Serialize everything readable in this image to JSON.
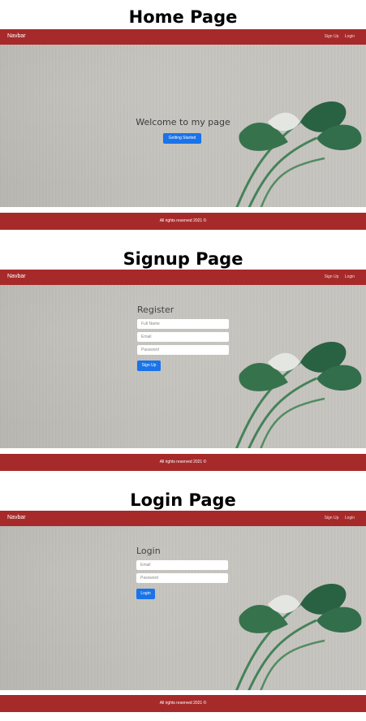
{
  "home": {
    "heading": "Home Page",
    "welcome": "Welcome to my page",
    "button_label": "Getting Started"
  },
  "signup": {
    "heading": "Signup Page",
    "title": "Register",
    "fields": [
      {
        "placeholder": "Full Name"
      },
      {
        "placeholder": "Email"
      },
      {
        "placeholder": "Password"
      }
    ],
    "button_label": "Sign Up"
  },
  "login": {
    "heading": "Login Page",
    "title": "Login",
    "fields": [
      {
        "placeholder": "Email"
      },
      {
        "placeholder": "Password"
      }
    ],
    "button_label": "Login"
  },
  "navbar": {
    "brand": "Navbar",
    "links": [
      "Sign Up",
      "Login"
    ]
  },
  "footer": {
    "text": "All rights reserved 2021 ©"
  },
  "colors": {
    "nav_footer_bg": "#a72a2a",
    "button_bg": "#1a73e8"
  }
}
